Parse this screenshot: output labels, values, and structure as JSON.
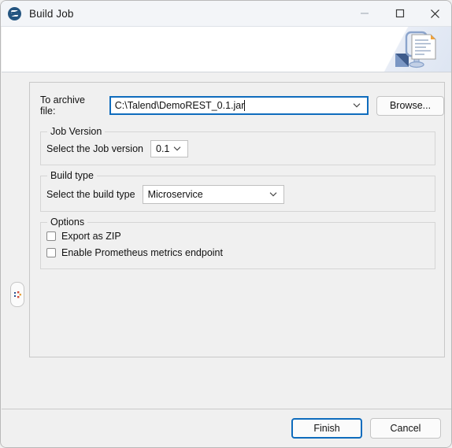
{
  "window": {
    "title": "Build Job",
    "app_icon": "talend-logo-icon",
    "controls": {
      "minimize": "minimize-icon",
      "maximize": "maximize-icon",
      "close": "close-icon"
    }
  },
  "banner": {
    "icon": "build-job-document-icon"
  },
  "side_handle": {
    "icon": "restore-panel-icon"
  },
  "archive": {
    "label": "To archive file:",
    "value": "C:\\Talend\\DemoREST_0.1.jar",
    "placeholder": "",
    "caret_icon": "chevron-down-icon",
    "browse_label": "Browse..."
  },
  "job_version": {
    "legend": "Job Version",
    "label": "Select the Job version",
    "value": "0.1",
    "options": [
      "0.1"
    ],
    "caret_icon": "chevron-down-icon"
  },
  "build_type": {
    "legend": "Build type",
    "label": "Select the build type",
    "value": "Microservice",
    "options": [
      "Microservice"
    ],
    "caret_icon": "chevron-down-icon"
  },
  "options": {
    "legend": "Options",
    "items": [
      {
        "label": "Export as ZIP",
        "checked": false
      },
      {
        "label": "Enable Prometheus metrics endpoint",
        "checked": false
      }
    ]
  },
  "footer": {
    "finish_label": "Finish",
    "cancel_label": "Cancel"
  },
  "colors": {
    "accent": "#0f6cbd",
    "window_bg": "#f0f0f0",
    "banner_bg": "#ffffff",
    "titlebar_bg": "#f3f5f8",
    "app_icon_bg": "#245580"
  }
}
